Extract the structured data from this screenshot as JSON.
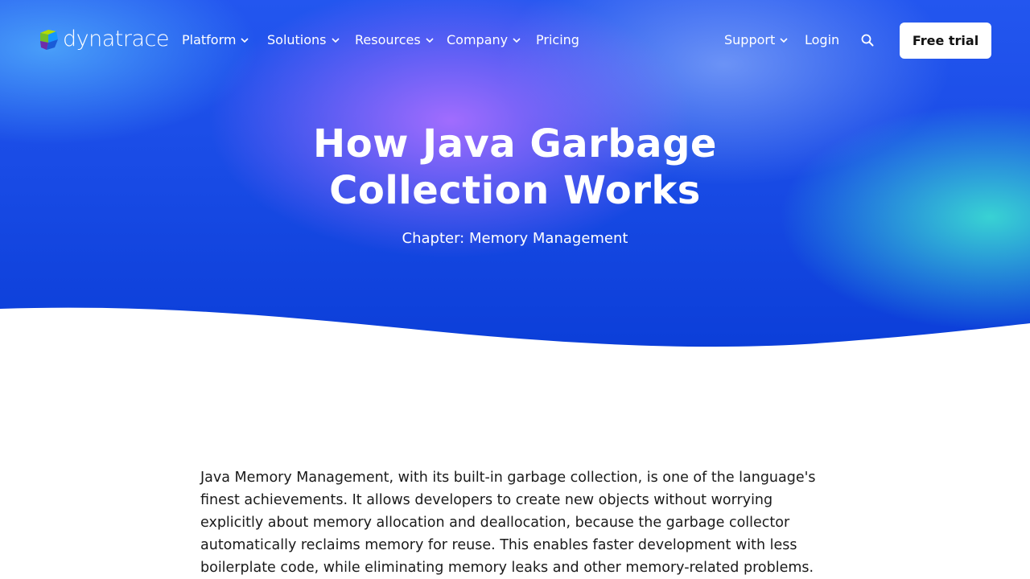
{
  "brand": {
    "name": "dynatrace"
  },
  "nav": {
    "platform": "Platform",
    "solutions": "Solutions",
    "resources": "Resources",
    "company": "Company",
    "pricing": "Pricing",
    "support": "Support",
    "login": "Login",
    "cta": "Free trial"
  },
  "hero": {
    "title": "How Java Garbage Collection Works",
    "chapter": "Chapter: Memory Management"
  },
  "article": {
    "intro": "Java Memory Management, with its built-in garbage collection, is one of the language's finest achievements. It allows developers to create new objects without worrying explicitly about memory allocation and deallocation, because the garbage collector automatically reclaims memory for reuse. This enables faster development with less boilerplate code, while eliminating memory leaks and other memory-related problems. At least in theory."
  },
  "colors": {
    "hero_blue": "#1a4ce6",
    "hero_purple": "#a86eff",
    "hero_teal": "#3ce1d2",
    "cta_bg": "#ffffff"
  },
  "icons": [
    "dynatrace-logo-mark",
    "chevron-down-icon",
    "search-icon"
  ]
}
